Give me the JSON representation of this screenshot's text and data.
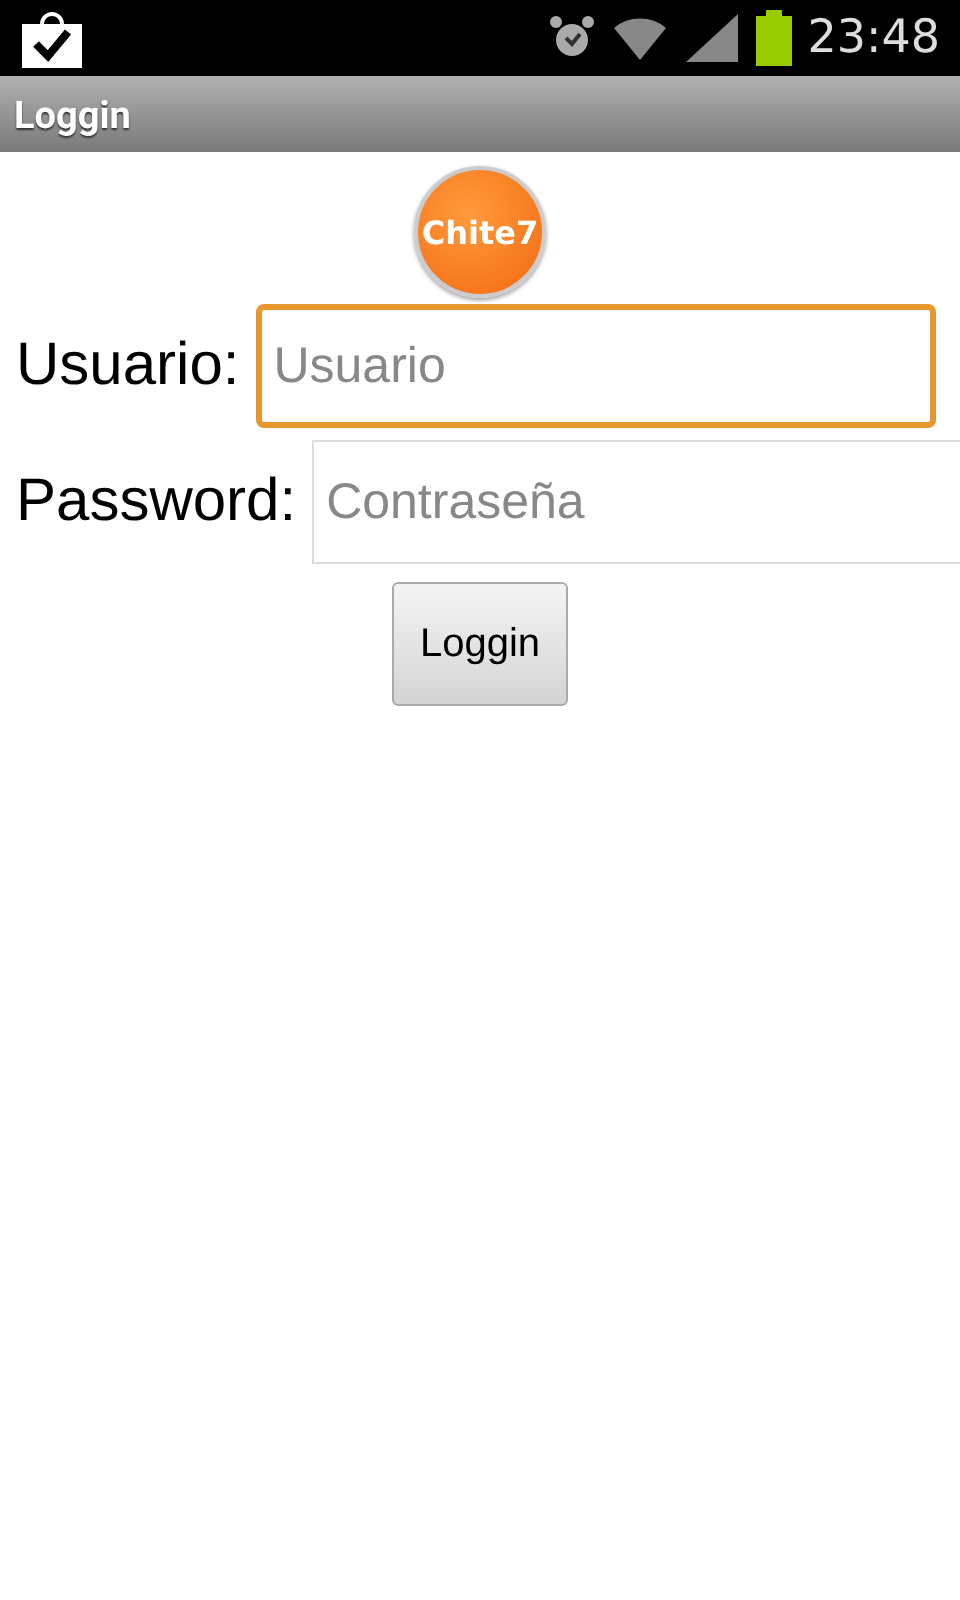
{
  "status_bar": {
    "time": "23:48"
  },
  "title_bar": {
    "title": "Loggin"
  },
  "logo": {
    "text": "Chite7"
  },
  "fields": [
    {
      "label": "Usuario:",
      "placeholder": "Usuario",
      "focused": true
    },
    {
      "label": "Password:",
      "placeholder": "Contraseña",
      "focused": false
    }
  ],
  "button": {
    "label": "Loggin"
  }
}
